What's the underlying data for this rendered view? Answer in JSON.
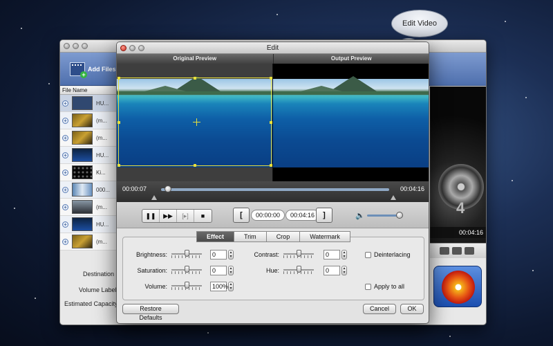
{
  "bubble": {
    "label": "Edit Video"
  },
  "main_window": {
    "toolbar": {
      "add_files_label": "Add Files"
    },
    "column_header": "File Name",
    "files": [
      {
        "name": "HU...",
        "thumb": "th1"
      },
      {
        "name": "(m...",
        "thumb": "th2"
      },
      {
        "name": "(m...",
        "thumb": "th2"
      },
      {
        "name": "HU...",
        "thumb": "th3"
      },
      {
        "name": "Ki...",
        "thumb": "th4"
      },
      {
        "name": "000...",
        "thumb": "th5"
      },
      {
        "name": "(m...",
        "thumb": "th6"
      },
      {
        "name": "HU...",
        "thumb": "th3"
      },
      {
        "name": "(m...",
        "thumb": "th2"
      }
    ],
    "destination_label": "Destination",
    "volume_label": "Volume Label",
    "estimated_capacity_label": "Estimated Capacity",
    "right_panel": {
      "disc_number": "4",
      "time": "00:04:16"
    }
  },
  "edit_dialog": {
    "title": "Edit",
    "original_preview_label": "Original Preview",
    "output_preview_label": "Output Preview",
    "timeline": {
      "current": "00:00:07",
      "total": "00:04:16",
      "position_fraction": 0.03
    },
    "controls": {
      "pause": "❚❚",
      "next_frame": "▶▶",
      "snapshot": "[▸]",
      "stop": "■",
      "start_bracket": "[",
      "start_time": "00:00:00",
      "end_time": "00:04:16",
      "end_bracket": "]",
      "volume_icon": "speaker-icon",
      "volume_fraction": 0.9
    },
    "tabs": [
      "Effect",
      "Trim",
      "Crop",
      "Watermark"
    ],
    "active_tab": "Effect",
    "effect": {
      "brightness_label": "Brightness:",
      "brightness_value": "0",
      "contrast_label": "Contrast:",
      "contrast_value": "0",
      "saturation_label": "Saturation:",
      "saturation_value": "0",
      "hue_label": "Hue:",
      "hue_value": "0",
      "volume_label": "Volume:",
      "volume_value": "100%",
      "deinterlacing_label": "Deinterlacing",
      "apply_all_label": "Apply to all"
    },
    "buttons": {
      "restore": "Restore Defaults",
      "cancel": "Cancel",
      "ok": "OK"
    }
  }
}
